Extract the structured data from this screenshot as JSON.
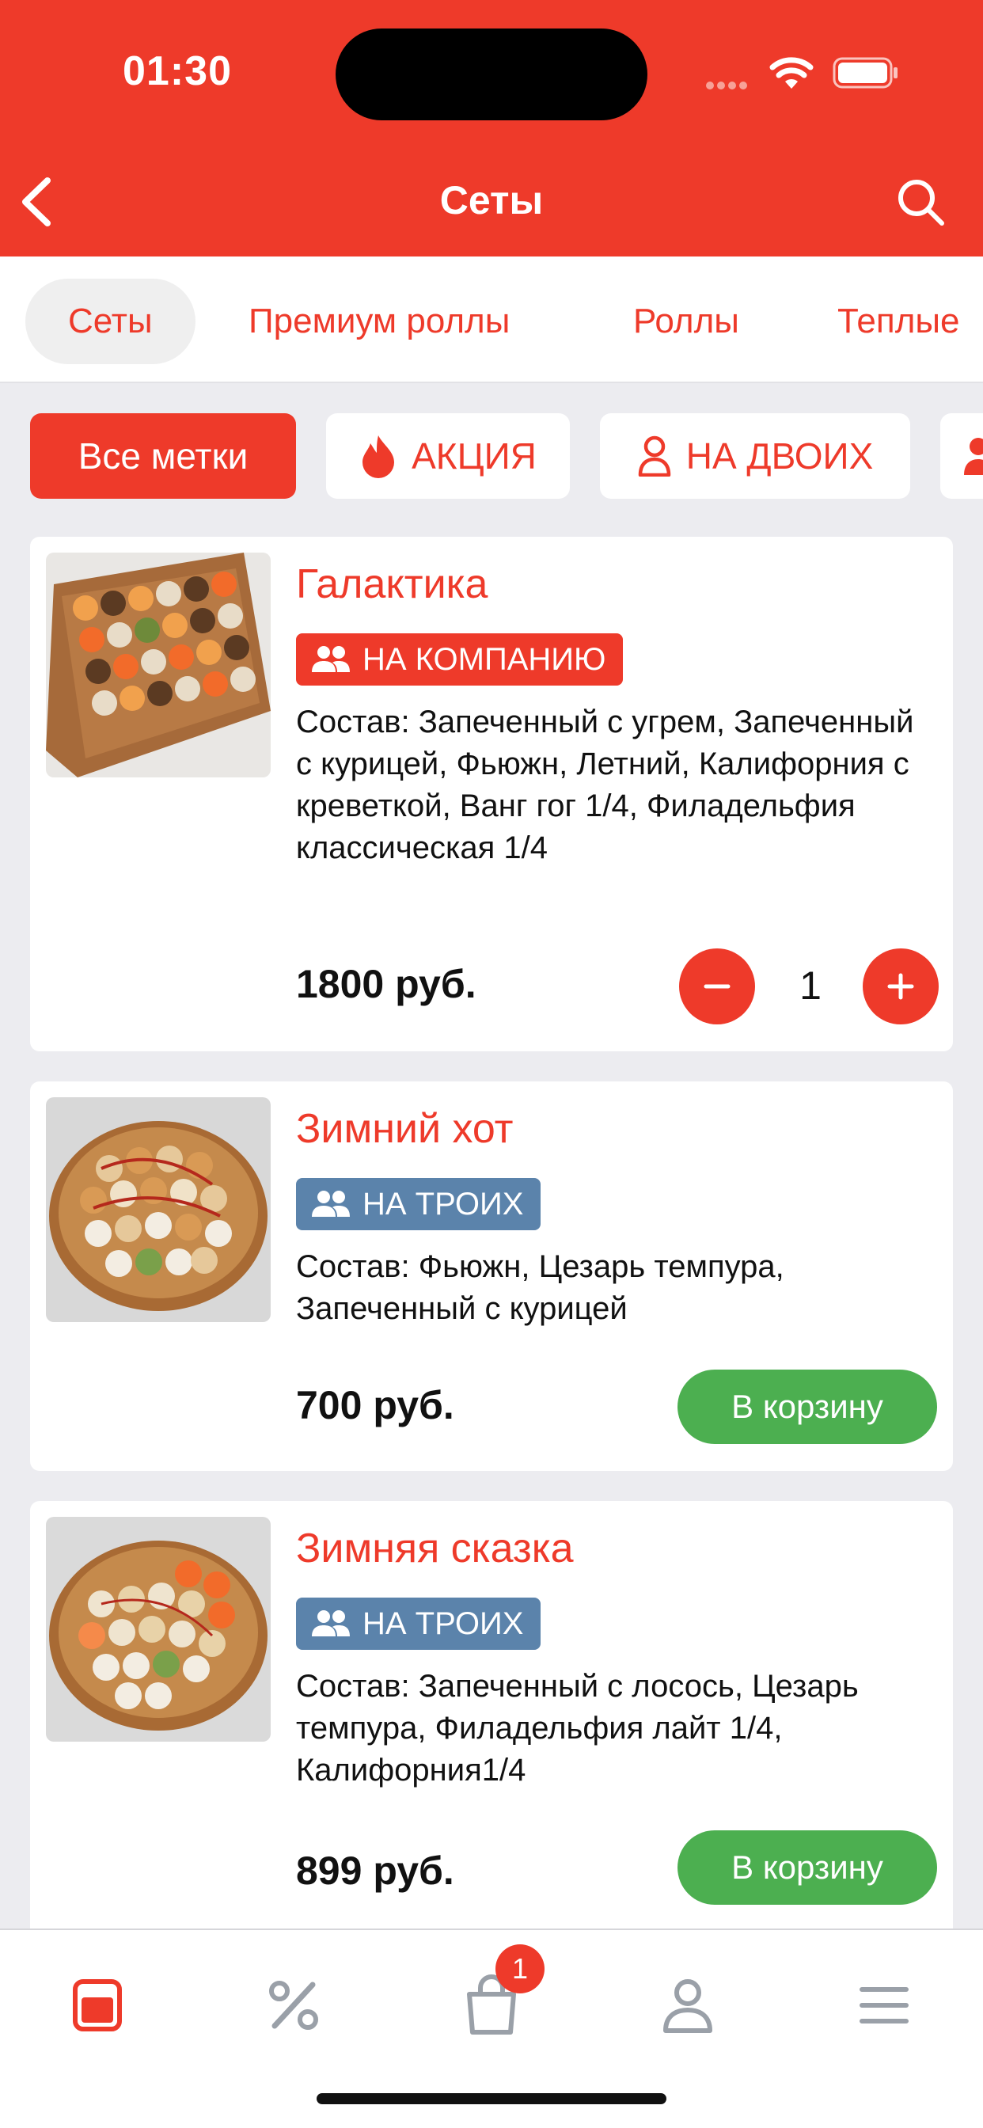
{
  "status_bar": {
    "time": "01:30"
  },
  "header": {
    "title": "Сеты"
  },
  "categories": [
    {
      "label": "Сеты",
      "active": true
    },
    {
      "label": "Премиум роллы",
      "active": false
    },
    {
      "label": "Роллы",
      "active": false
    },
    {
      "label": "Теплые",
      "active": false
    }
  ],
  "tag_filters": [
    {
      "label": "Все метки",
      "icon": "",
      "active": true
    },
    {
      "label": "АКЦИЯ",
      "icon": "fire-icon",
      "active": false
    },
    {
      "label": "НА ДВОИХ",
      "icon": "person-icon",
      "active": false
    }
  ],
  "products": [
    {
      "title": "Галактика",
      "badge": "НА КОМПАНИЮ",
      "badge_color": "#ee3a2a",
      "description": "Состав: Запеченный с угрем, Запеченный с курицей, Фьюжн, Летний, Калифорния с креветкой, Ванг гог 1/4, Филадельфия классическая 1/4",
      "price": "1800 руб.",
      "quantity": "1"
    },
    {
      "title": "Зимний хот",
      "badge": "НА ТРОИХ",
      "badge_color": "#5b83ab",
      "description": "Состав: Фьюжн, Цезарь темпура, Запеченный с курицей",
      "price": "700 руб.",
      "button": "В корзину"
    },
    {
      "title": "Зимняя сказка",
      "badge": "НА ТРОИХ",
      "badge_color": "#5b83ab",
      "description": "Состав: Запеченный с лосось, Цезарь темпура, Филадельфия лайт 1/4, Калифорния1/4",
      "price": "899 руб.",
      "button": "В корзину"
    }
  ],
  "bottom_nav": {
    "items": [
      "menu-icon",
      "discount-icon",
      "cart-icon",
      "profile-icon",
      "more-icon"
    ],
    "cart_count": "1"
  },
  "colors": {
    "accent": "#ee3a2a",
    "button_green": "#4caf50",
    "badge_blue": "#5b83ab"
  }
}
